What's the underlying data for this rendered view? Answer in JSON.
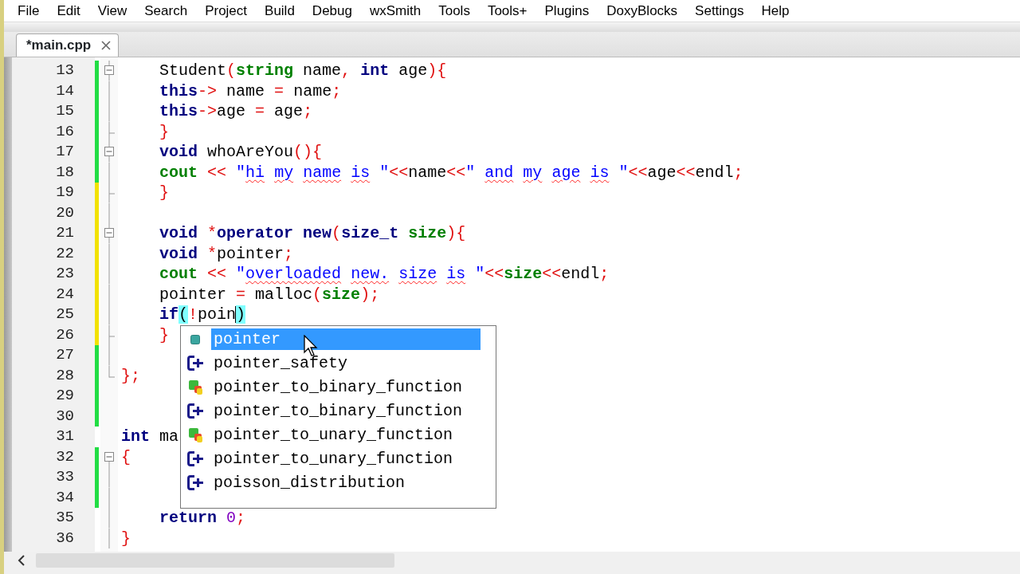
{
  "menu": [
    "File",
    "Edit",
    "View",
    "Search",
    "Project",
    "Build",
    "Debug",
    "wxSmith",
    "Tools",
    "Tools+",
    "Plugins",
    "DoxyBlocks",
    "Settings",
    "Help"
  ],
  "tabs": [
    {
      "label": "*main.cpp",
      "selected": true
    }
  ],
  "editor": {
    "lines": [
      {
        "number": "13",
        "color": "#22dd44",
        "fold": {
          "kind": "start"
        },
        "tokens": [
          {
            "text": "    Student",
            "kind": "plain"
          },
          {
            "text": "(",
            "kind": "op"
          },
          {
            "text": "string",
            "kind": "lib"
          },
          {
            "text": " name",
            "kind": "plain"
          },
          {
            "text": ",",
            "kind": "op"
          },
          {
            "text": " int",
            "kind": "kw"
          },
          {
            "text": " age",
            "kind": "plain"
          },
          {
            "text": "){",
            "kind": "op"
          }
        ]
      },
      {
        "number": "14",
        "color": "#22dd44",
        "fold": {
          "kind": "mid"
        },
        "tokens": [
          {
            "text": "    this",
            "kind": "kw"
          },
          {
            "text": "->",
            "kind": "op"
          },
          {
            "text": " name",
            "kind": "plain"
          },
          {
            "text": " =",
            "kind": "op"
          },
          {
            "text": " name",
            "kind": "plain"
          },
          {
            "text": ";",
            "kind": "op"
          }
        ]
      },
      {
        "number": "15",
        "color": "#22dd44",
        "fold": {
          "kind": "mid"
        },
        "tokens": [
          {
            "text": "    this",
            "kind": "kw"
          },
          {
            "text": "->",
            "kind": "op"
          },
          {
            "text": "age",
            "kind": "plain"
          },
          {
            "text": " =",
            "kind": "op"
          },
          {
            "text": " age",
            "kind": "plain"
          },
          {
            "text": ";",
            "kind": "op"
          }
        ]
      },
      {
        "number": "16",
        "color": "#22dd44",
        "fold": {
          "kind": "end"
        },
        "tokens": [
          {
            "text": "    }",
            "kind": "op"
          }
        ]
      },
      {
        "number": "17",
        "color": "#22dd44",
        "fold": {
          "kind": "start"
        },
        "tokens": [
          {
            "text": "    void",
            "kind": "kw"
          },
          {
            "text": " whoAreYou",
            "kind": "plain"
          },
          {
            "text": "(){",
            "kind": "op"
          }
        ]
      },
      {
        "number": "18",
        "color": "#22dd44",
        "fold": {
          "kind": "mid"
        },
        "tokens": [
          {
            "text": "    cout",
            "kind": "lib"
          },
          {
            "text": " <<",
            "kind": "op"
          },
          {
            "text": " \"",
            "kind": "str"
          },
          {
            "text": "hi",
            "kind": "misspelled"
          },
          {
            "text": " my",
            "kind": "misspelled"
          },
          {
            "text": " name",
            "kind": "misspelled"
          },
          {
            "text": " is",
            "kind": "misspelled"
          },
          {
            "text": " \"",
            "kind": "str"
          },
          {
            "text": "<<",
            "kind": "op"
          },
          {
            "text": "name",
            "kind": "plain"
          },
          {
            "text": "<<",
            "kind": "op"
          },
          {
            "text": "\"",
            "kind": "str"
          },
          {
            "text": " and",
            "kind": "misspelled"
          },
          {
            "text": " my",
            "kind": "misspelled"
          },
          {
            "text": " age",
            "kind": "misspelled"
          },
          {
            "text": " is",
            "kind": "misspelled"
          },
          {
            "text": " \"",
            "kind": "str"
          },
          {
            "text": "<<",
            "kind": "op"
          },
          {
            "text": "age",
            "kind": "plain"
          },
          {
            "text": "<<",
            "kind": "op"
          },
          {
            "text": "endl",
            "kind": "plain"
          },
          {
            "text": ";",
            "kind": "op"
          }
        ]
      },
      {
        "number": "19",
        "color": "#f2e200",
        "fold": {
          "kind": "end"
        },
        "tokens": [
          {
            "text": "    }",
            "kind": "op"
          }
        ]
      },
      {
        "number": "20",
        "color": "#f2e200",
        "fold": {
          "kind": "mid"
        }
      },
      {
        "number": "21",
        "color": "#f2e200",
        "fold": {
          "kind": "start"
        },
        "tokens": [
          {
            "text": "    void",
            "kind": "kw"
          },
          {
            "text": " *",
            "kind": "op"
          },
          {
            "text": "operator",
            "kind": "kw"
          },
          {
            "text": " new",
            "kind": "kw"
          },
          {
            "text": "(",
            "kind": "op"
          },
          {
            "text": "size_t",
            "kind": "kw"
          },
          {
            "text": " size",
            "kind": "lib"
          },
          {
            "text": "){",
            "kind": "op"
          }
        ]
      },
      {
        "number": "22",
        "color": "#f2e200",
        "fold": {
          "kind": "mid"
        },
        "tokens": [
          {
            "text": "    void",
            "kind": "kw"
          },
          {
            "text": " *",
            "kind": "op"
          },
          {
            "text": "pointer",
            "kind": "plain"
          },
          {
            "text": ";",
            "kind": "op"
          }
        ]
      },
      {
        "number": "23",
        "color": "#f2e200",
        "fold": {
          "kind": "mid"
        },
        "tokens": [
          {
            "text": "    cout",
            "kind": "lib"
          },
          {
            "text": " <<",
            "kind": "op"
          },
          {
            "text": " \"",
            "kind": "str"
          },
          {
            "text": "overloaded",
            "kind": "misspelled"
          },
          {
            "text": " new.",
            "kind": "misspelled"
          },
          {
            "text": " size",
            "kind": "misspelled"
          },
          {
            "text": " is",
            "kind": "misspelled"
          },
          {
            "text": " \"",
            "kind": "str"
          },
          {
            "text": "<<",
            "kind": "op"
          },
          {
            "text": "size",
            "kind": "lib"
          },
          {
            "text": "<<",
            "kind": "op"
          },
          {
            "text": "endl",
            "kind": "plain"
          },
          {
            "text": ";",
            "kind": "op"
          }
        ]
      },
      {
        "number": "24",
        "color": "#f2e200",
        "fold": {
          "kind": "mid"
        },
        "tokens": [
          {
            "text": "    pointer",
            "kind": "plain"
          },
          {
            "text": " =",
            "kind": "op"
          },
          {
            "text": " malloc",
            "kind": "plain"
          },
          {
            "text": "(",
            "kind": "op"
          },
          {
            "text": "size",
            "kind": "lib"
          },
          {
            "text": ");",
            "kind": "op"
          }
        ]
      },
      {
        "number": "25",
        "color": "#f2e200",
        "fold": {
          "kind": "mid"
        },
        "tokens": [
          {
            "text": "    if",
            "kind": "kw"
          },
          {
            "text": "(",
            "kind": "brace"
          },
          {
            "text": "!",
            "kind": "op"
          },
          {
            "text": "poin",
            "kind": "plain",
            "caret": true
          },
          {
            "text": ")",
            "kind": "brace"
          }
        ]
      },
      {
        "number": "26",
        "color": "#f2e200",
        "fold": {
          "kind": "end"
        },
        "tokens": [
          {
            "text": "    }",
            "kind": "op"
          }
        ]
      },
      {
        "number": "27",
        "color": "#22dd44",
        "fold": {
          "kind": "mid"
        }
      },
      {
        "number": "28",
        "color": "#22dd44",
        "fold": {
          "kind": "close"
        },
        "tokens": [
          {
            "text": "};",
            "kind": "op"
          }
        ]
      },
      {
        "number": "29",
        "color": "#22dd44"
      },
      {
        "number": "30",
        "color": "#22dd44"
      },
      {
        "number": "31",
        "tokens": [
          {
            "text": "int",
            "kind": "kw"
          },
          {
            "text": " ma",
            "kind": "plain"
          }
        ]
      },
      {
        "number": "32",
        "color": "#22dd44",
        "fold": {
          "kind": "first"
        },
        "tokens": [
          {
            "text": "{",
            "kind": "op"
          }
        ]
      },
      {
        "number": "33",
        "color": "#22dd44",
        "fold": {
          "kind": "mid"
        }
      },
      {
        "number": "34",
        "color": "#22dd44",
        "fold": {
          "kind": "mid"
        }
      },
      {
        "number": "35",
        "fold": {
          "kind": "mid"
        },
        "tokens": [
          {
            "text": "    return",
            "kind": "kw"
          },
          {
            "text": " 0",
            "kind": "num"
          },
          {
            "text": ";",
            "kind": "op"
          }
        ]
      },
      {
        "number": "36",
        "fold": {
          "kind": "mid"
        },
        "tokens": [
          {
            "text": "}",
            "kind": "op"
          }
        ]
      }
    ]
  },
  "autocomplete": {
    "items": [
      {
        "label": "pointer",
        "kind": "variable",
        "selected": true
      },
      {
        "label": "pointer_safety",
        "kind": "class",
        "selected": false
      },
      {
        "label": "pointer_to_binary_function",
        "kind": "function",
        "selected": false
      },
      {
        "label": "pointer_to_binary_function",
        "kind": "class",
        "selected": false
      },
      {
        "label": "pointer_to_unary_function",
        "kind": "function",
        "selected": false
      },
      {
        "label": "pointer_to_unary_function",
        "kind": "class",
        "selected": false
      },
      {
        "label": "poisson_distribution",
        "kind": "class",
        "selected": false
      }
    ]
  }
}
